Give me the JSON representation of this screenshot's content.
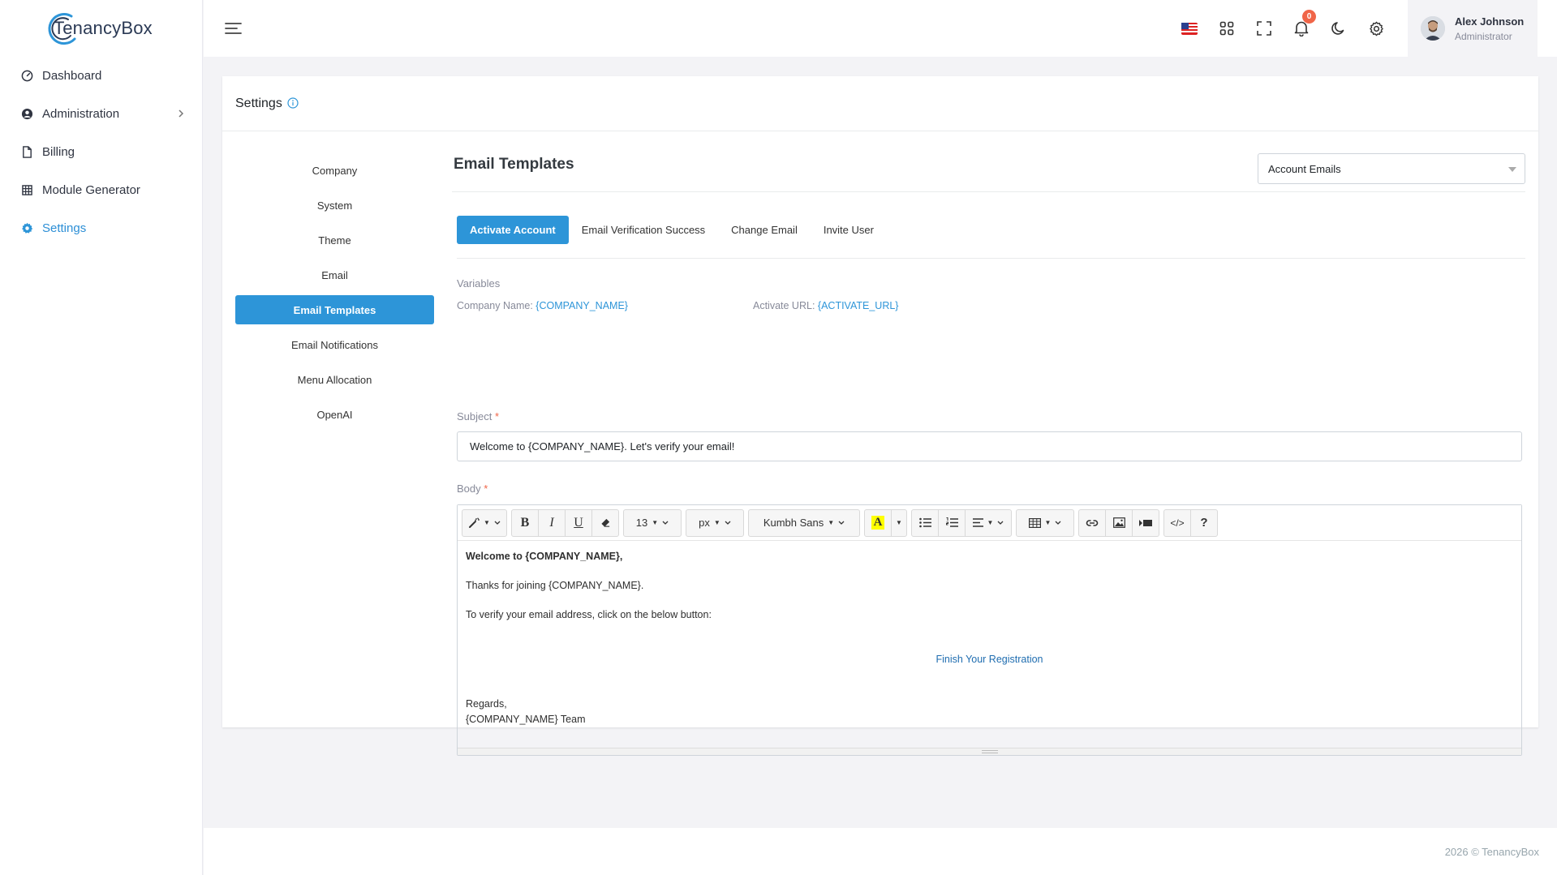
{
  "brand": {
    "name": "TenancyBox"
  },
  "sidebar": {
    "items": [
      {
        "label": "Dashboard",
        "icon": "gauge-icon"
      },
      {
        "label": "Administration",
        "icon": "user-circle-icon"
      },
      {
        "label": "Billing",
        "icon": "file-icon"
      },
      {
        "label": "Module Generator",
        "icon": "grid-icon"
      },
      {
        "label": "Settings",
        "icon": "gear-icon"
      }
    ]
  },
  "topbar": {
    "notifications_count": "0",
    "user": {
      "name": "Alex Johnson",
      "role": "Administrator"
    }
  },
  "page": {
    "title": "Settings"
  },
  "settings_nav": [
    "Company",
    "System",
    "Theme",
    "Email",
    "Email Templates",
    "Email Notifications",
    "Menu Allocation",
    "OpenAI"
  ],
  "email_templates": {
    "title": "Email Templates",
    "category": "Account Emails",
    "tabs": [
      "Activate Account",
      "Email Verification Success",
      "Change Email",
      "Invite User"
    ],
    "variables_label": "Variables",
    "variables": [
      {
        "label": "Company Name:",
        "token": "{COMPANY_NAME}"
      },
      {
        "label": "Activate URL:",
        "token": "{ACTIVATE_URL}"
      }
    ],
    "subject_label": "Subject",
    "subject_value": "Welcome to {COMPANY_NAME}. Let's verify your email!",
    "body_label": "Body",
    "required_mark": "*"
  },
  "editor": {
    "font_size": "13",
    "font_unit": "px",
    "font_family": "Kumbh Sans",
    "body": {
      "greeting": "Welcome to {COMPANY_NAME},",
      "line1": "Thanks for joining {COMPANY_NAME}.",
      "line2": "To verify your email address, click on the below button:",
      "button_text": "Finish Your Registration",
      "regards": "Regards,",
      "signature": "{COMPANY_NAME} Team"
    }
  },
  "footer": {
    "text": "2026 © TenancyBox"
  },
  "colors": {
    "accent": "#2d95d8",
    "badge": "#f06548"
  }
}
